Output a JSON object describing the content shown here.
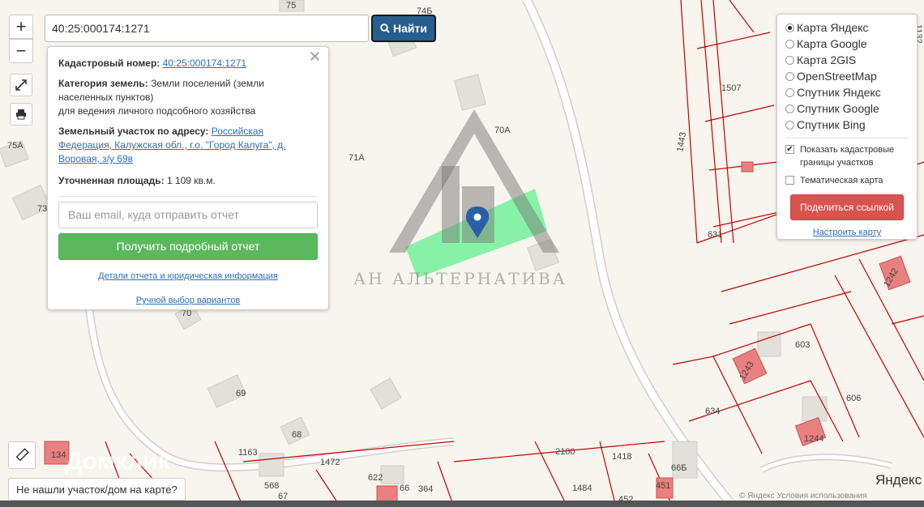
{
  "search": {
    "value": "40:25:000174:1271",
    "button_label": "Найти"
  },
  "zoom": {
    "plus": "+",
    "minus": "−"
  },
  "info": {
    "cadastral_label": "Кадастровый номер:",
    "cadastral_value": "40:25:000174:1271",
    "category_label": "Категория земель:",
    "category_value": "Земли поселений (земли населенных пунктов)",
    "category_use": "для ведения личного подсобного хозяйства",
    "address_label": "Земельный участок по адресу:",
    "address_value": "Российская Федерация, Калужская обл., г.о. \"Город Калуга\", д. Воровая, з/у 69в",
    "area_label": "Уточненная площадь:",
    "area_value": "1 109 кв.м.",
    "email_placeholder": "Ваш email, куда отправить отчет",
    "report_button": "Получить подробный отчет",
    "details_link": "Детали отчета и юридическая информация",
    "manual_link": "Ручной выбор вариантов"
  },
  "layers": {
    "options": [
      "Карта Яндекс",
      "Карта Google",
      "Карта 2GIS",
      "OpenStreetMap",
      "Спутник Яндекс",
      "Спутник Google",
      "Спутник Bing"
    ],
    "selected": "Карта Яндекс",
    "show_borders": "Показать кадастровые границы участков",
    "thematic": "Тематическая карта",
    "share_button": "Поделиться ссылкой",
    "setup_link": "Настроить карту"
  },
  "bottom_note": "Не нашли участок/дом на карте?",
  "watermark": "АН АЛЬТЕРНАТИВА",
  "domclick": "Домклик",
  "yandex_logo": "Яндекс",
  "attribution": "© Яндекс Условия использования",
  "map_labels": [
    "75",
    "74Б",
    "1132",
    "1507",
    "1443",
    "70А",
    "71А",
    "75А",
    "73",
    "631",
    "1242",
    "603",
    "1243",
    "606",
    "634",
    "1244",
    "69",
    "68",
    "70",
    "1163",
    "1472",
    "2100",
    "1418",
    "66Б",
    "134",
    "568",
    "67",
    "622",
    "66",
    "364",
    "1484",
    "452",
    "451"
  ],
  "colors": {
    "accent": "#285e8e",
    "green": "#5cb85c",
    "red": "#d9534f",
    "cadastre": "#c80000"
  }
}
